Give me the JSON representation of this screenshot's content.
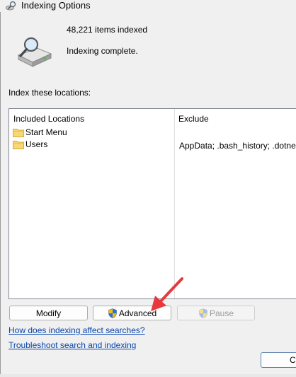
{
  "window": {
    "title": "Indexing Options"
  },
  "summary": {
    "items_indexed": "48,221 items indexed",
    "status": "Indexing complete."
  },
  "locations": {
    "section_label": "Index these locations:",
    "columns": {
      "included": "Included Locations",
      "exclude": "Exclude"
    },
    "rows": [
      {
        "name": "Start Menu",
        "exclude": ""
      },
      {
        "name": "Users",
        "exclude": "AppData; .bash_history; .dotnet;"
      }
    ]
  },
  "buttons": {
    "modify": "Modify",
    "advanced": "Advanced",
    "pause": "Pause",
    "close": "Cl"
  },
  "links": {
    "how_indexing": "How does indexing affect searches?",
    "troubleshoot": "Troubleshoot search and indexing"
  },
  "colors": {
    "link": "#0645ad",
    "arrow": "#e8383d",
    "folder": "#f8d775",
    "shield_blue": "#2f6fd6",
    "shield_yellow": "#f5c000"
  }
}
